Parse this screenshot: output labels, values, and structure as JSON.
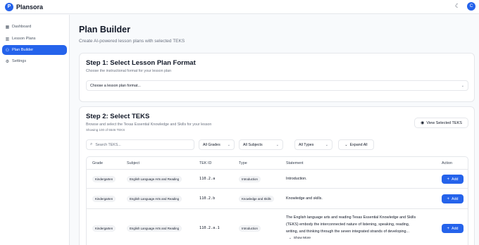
{
  "app": {
    "logo_letter": "P",
    "name": "Plansora",
    "user_initial": "C",
    "theme_icon": "moon-icon"
  },
  "sidebar": {
    "items": [
      {
        "label": "Dashboard",
        "icon": "grid-icon",
        "active": false
      },
      {
        "label": "Lesson Plans",
        "icon": "book-icon",
        "active": false
      },
      {
        "label": "Plan Builder",
        "icon": "user-icon",
        "active": true
      },
      {
        "label": "Settings",
        "icon": "gear-icon",
        "active": false
      }
    ]
  },
  "page": {
    "title": "Plan Builder",
    "subtitle": "Create AI-powered lesson plans with selected TEKS"
  },
  "step1": {
    "title": "Step 1: Select Lesson Plan Format",
    "description": "Choose the instructional format for your lesson plan",
    "select_placeholder": "Choose a lesson plan format..."
  },
  "step2": {
    "title": "Step 2: Select TEKS",
    "description": "Browse and select the Texas Essential Knowledge and Skills for your lesson",
    "showing": "Showing 100 of 5546 TEKS",
    "view_selected_label": "View Selected TEKS",
    "search_placeholder": "Search TEKS...",
    "filters": {
      "grades": "All Grades",
      "subjects": "All Subjects",
      "types": "All Types"
    },
    "expand_all_label": "Expand All",
    "columns": {
      "grade": "Grade",
      "subject": "Subject",
      "tek_id": "TEK ID",
      "type": "Type",
      "statement": "Statement",
      "action": "Action"
    },
    "rows": [
      {
        "grade": "Kindergarten",
        "subject": "English Language Arts and Reading",
        "tek_id": "110.2.a",
        "type": "Introduction",
        "statement": "Introduction.",
        "action": "Add"
      },
      {
        "grade": "Kindergarten",
        "subject": "English Language Arts and Reading",
        "tek_id": "110.2.b",
        "type": "Knowledge and Skills",
        "statement": "Knowledge and skills.",
        "action": "Add"
      },
      {
        "grade": "Kindergarten",
        "subject": "English Language Arts and Reading",
        "tek_id": "110.2.a.1",
        "type": "Introduction",
        "statement_lines": [
          "The English language arts and reading Texas Essential Knowledge and Skills",
          "(TEKS) embody the interconnected nature of listening, speaking, reading,",
          "writing, and thinking through the seven integrated strands of developing..."
        ],
        "show_more": "Show More",
        "action": "Add"
      }
    ]
  },
  "colors": {
    "accent": "#2563eb",
    "border": "#e5e7eb",
    "muted": "#6b7280"
  }
}
